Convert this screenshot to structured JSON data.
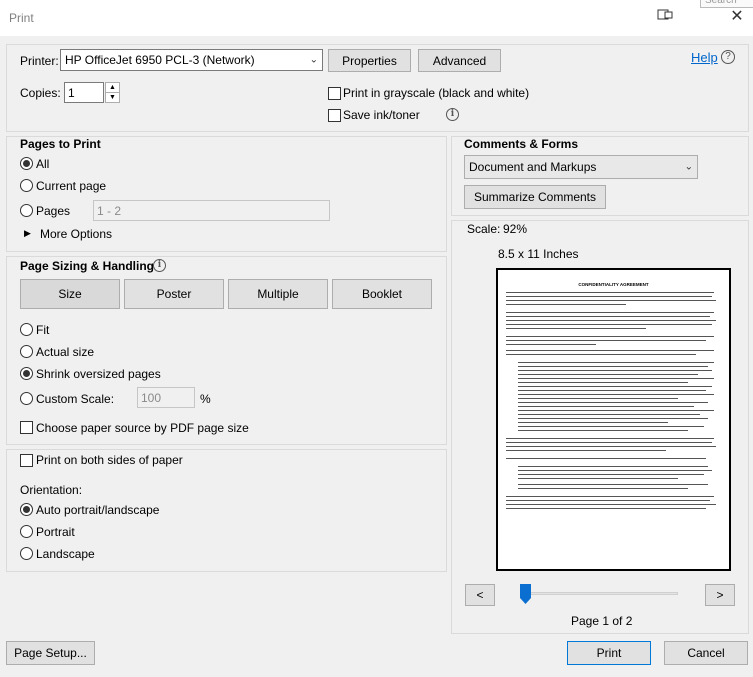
{
  "window": {
    "title": "Print",
    "behind_text": "Search"
  },
  "printer": {
    "label": "Printer:",
    "selected": "HP OfficeJet 6950 PCL-3 (Network)",
    "properties": "Properties",
    "advanced": "Advanced",
    "help": "Help"
  },
  "copies": {
    "label": "Copies:",
    "value": "1"
  },
  "options": {
    "grayscale": "Print in grayscale (black and white)",
    "save_ink": "Save ink/toner"
  },
  "pages": {
    "header": "Pages to Print",
    "all": "All",
    "current": "Current page",
    "pages": "Pages",
    "range": "1 - 2",
    "more": "More Options"
  },
  "sizing": {
    "header": "Page Sizing & Handling",
    "tabs": [
      "Size",
      "Poster",
      "Multiple",
      "Booklet"
    ],
    "fit": "Fit",
    "actual": "Actual size",
    "shrink": "Shrink oversized pages",
    "custom": "Custom Scale:",
    "custom_value": "100",
    "percent": "%",
    "paper_source": "Choose paper source by PDF page size"
  },
  "duplex": {
    "label": "Print on both sides of paper"
  },
  "orientation": {
    "header": "Orientation:",
    "auto": "Auto portrait/landscape",
    "portrait": "Portrait",
    "landscape": "Landscape"
  },
  "comments": {
    "header": "Comments & Forms",
    "selected": "Document and Markups",
    "summarize": "Summarize Comments"
  },
  "preview": {
    "scale_label": "Scale:",
    "scale_value": "92%",
    "paper": "8.5 x 11 Inches",
    "doc_title": "CONFIDENTIALITY AGREEMENT",
    "prev": "<",
    "next": ">",
    "page_info": "Page 1 of 2"
  },
  "footer": {
    "page_setup": "Page Setup...",
    "print": "Print",
    "cancel": "Cancel"
  }
}
